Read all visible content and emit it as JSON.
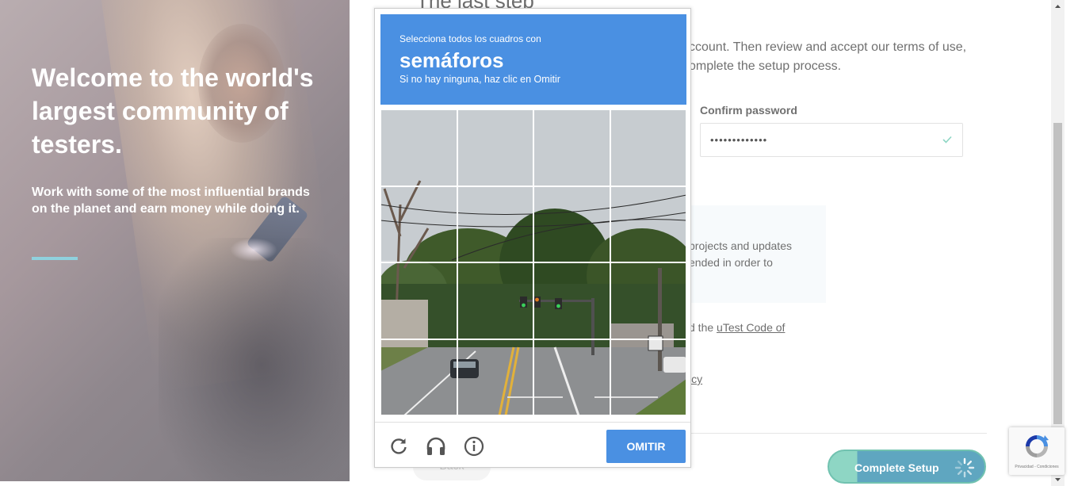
{
  "hero": {
    "title": "Welcome to the world's largest community of testers.",
    "subtitle": "Work with some of the most influential brands on the planet and earn money while doing it."
  },
  "form": {
    "step_title": "The last step",
    "intro": "ccount. Then review and accept our terms of use,\nomplete the setup process.",
    "confirm_password_label": "Confirm password",
    "confirm_password_value": "•••••••••••••",
    "info_text": "projects and updates\nended in order to",
    "code_prefix": "d the ",
    "code_link": "uTest Code of",
    "policy_fragment": "icy",
    "back_label": "Back",
    "complete_label": "Complete Setup"
  },
  "captcha": {
    "instruction": "Selecciona todos los cuadros con",
    "keyword": "semáforos",
    "hint": "Si no hay ninguna, haz clic en Omitir",
    "skip_label": "OMITIR",
    "reload_icon": "reload-icon",
    "audio_icon": "headphones-icon",
    "info_icon": "info-icon"
  },
  "recaptcha_badge": {
    "terms": "Privacidad - Condiciones"
  },
  "colors": {
    "captcha_blue": "#4a90e2",
    "accent_line": "#8fd1de",
    "complete_button": "#5fa6c0"
  }
}
